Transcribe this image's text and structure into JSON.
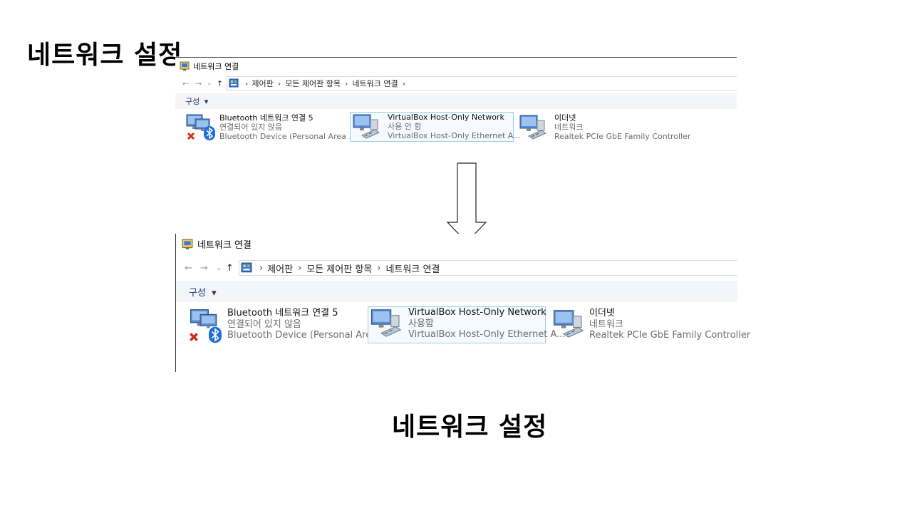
{
  "slide": {
    "title_top": "네트워크 설정",
    "title_bottom": "네트워크 설정"
  },
  "window": {
    "title": "네트워크 연결",
    "nav": {
      "back": "←",
      "forward": "→",
      "recent": "⌄",
      "up": "↑"
    },
    "breadcrumb": [
      "제어판",
      "모든 제어판 항목",
      "네트워크 연결"
    ],
    "command_bar": {
      "organize_label": "구성",
      "organize_caret": "▾"
    }
  },
  "before": {
    "adapters": [
      {
        "name": "Bluetooth 네트워크 연결 5",
        "status": "연결되어 있지 않음",
        "device": "Bluetooth Device (Personal Area ...",
        "icon": "bluetooth-adapter-icon",
        "badge": "disconnected-x-icon"
      },
      {
        "name": "VirtualBox Host-Only Network",
        "status": "사용 안 함",
        "device": "VirtualBox Host-Only Ethernet A...",
        "icon": "network-adapter-icon",
        "selected": true
      },
      {
        "name": "이더넷",
        "status": "네트워크",
        "device": "Realtek PCIe GbE Family Controller",
        "icon": "network-adapter-icon"
      }
    ]
  },
  "after": {
    "adapters": [
      {
        "name": "Bluetooth 네트워크 연결 5",
        "status": "연결되어 있지 않음",
        "device": "Bluetooth Device (Personal Area ...",
        "icon": "bluetooth-adapter-icon",
        "badge": "disconnected-x-icon"
      },
      {
        "name": "VirtualBox Host-Only Network",
        "status": "사용함",
        "device": "VirtualBox Host-Only Ethernet A...",
        "icon": "network-adapter-icon",
        "selected": true
      },
      {
        "name": "이더넷",
        "status": "네트워크",
        "device": "Realtek PCIe GbE Family Controller",
        "icon": "network-adapter-icon"
      }
    ]
  },
  "colors": {
    "selection_border": "#99d1ee",
    "command_bar_bg": "#f3f5f7",
    "bluetooth_blue": "#1e6fd9",
    "error_red": "#d9261c"
  }
}
